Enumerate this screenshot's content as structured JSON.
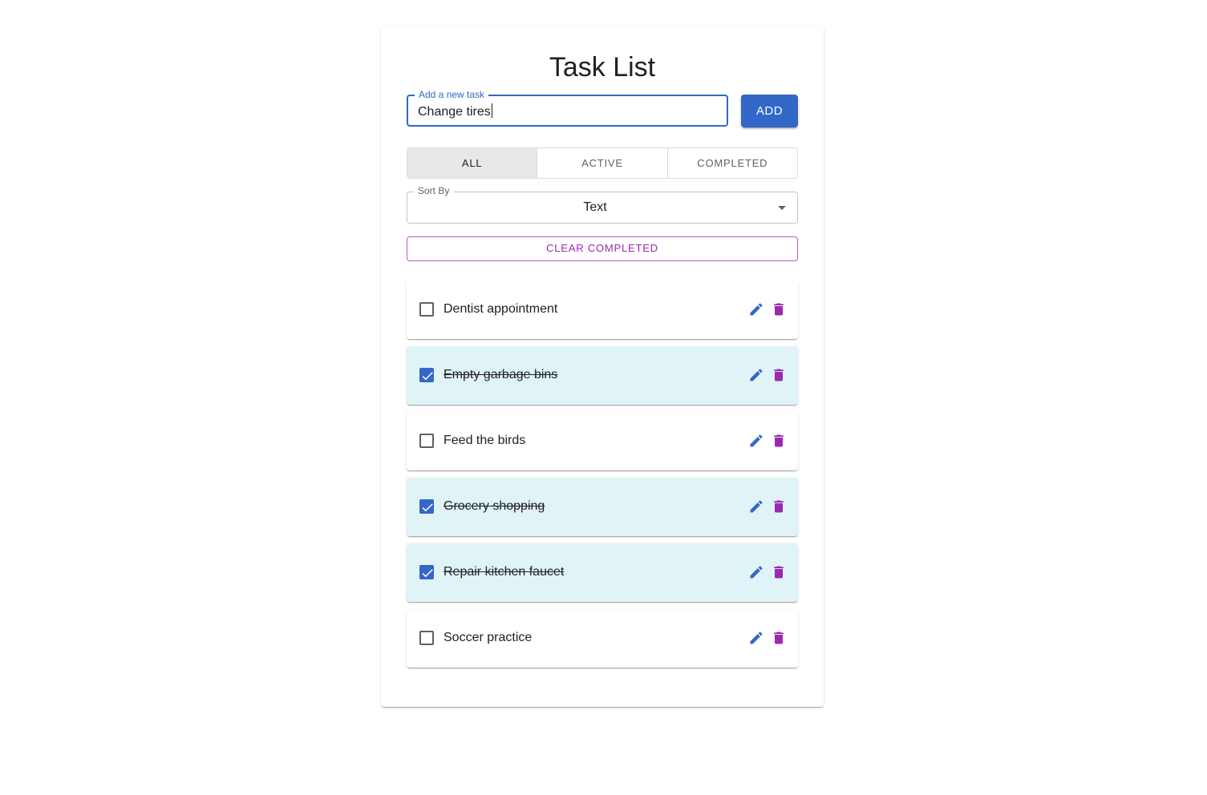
{
  "header": {
    "title": "Task List"
  },
  "new_task": {
    "label": "Add a new task",
    "value": "Change tires",
    "add_label": "ADD"
  },
  "filters": [
    {
      "label": "ALL",
      "selected": true
    },
    {
      "label": "ACTIVE",
      "selected": false
    },
    {
      "label": "COMPLETED",
      "selected": false
    }
  ],
  "sort": {
    "label": "Sort By",
    "value": "Text"
  },
  "clear_label": "CLEAR COMPLETED",
  "tasks": [
    {
      "text": "Dentist appointment",
      "completed": false
    },
    {
      "text": "Empty garbage bins",
      "completed": true
    },
    {
      "text": "Feed the birds",
      "completed": false
    },
    {
      "text": "Grocery shopping",
      "completed": true
    },
    {
      "text": "Repair kitchen faucet",
      "completed": true
    },
    {
      "text": "Soccer practice",
      "completed": false
    }
  ],
  "colors": {
    "primary": "#3367c8",
    "secondary": "#9c27b0",
    "completed_bg": "#e0f4f8"
  },
  "icons": {
    "edit": "pencil-icon",
    "delete": "trash-icon",
    "check": "check-icon"
  }
}
